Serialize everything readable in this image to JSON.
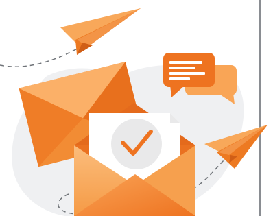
{
  "illustration": {
    "subject": "email-sent",
    "icons": [
      "paper-plane-icon",
      "chat-bubbles-icon",
      "envelope-icon",
      "open-envelope-icon",
      "checkmark-icon",
      "paper-plane-icon"
    ],
    "colors": {
      "orange": "#f5852a",
      "orange_light": "#f8a85a",
      "orange_dark": "#e2661a",
      "blob": "#eff0f2",
      "dash": "#6f7378",
      "divider": "#8a8d92",
      "check_circle": "#e9e9ea"
    }
  }
}
